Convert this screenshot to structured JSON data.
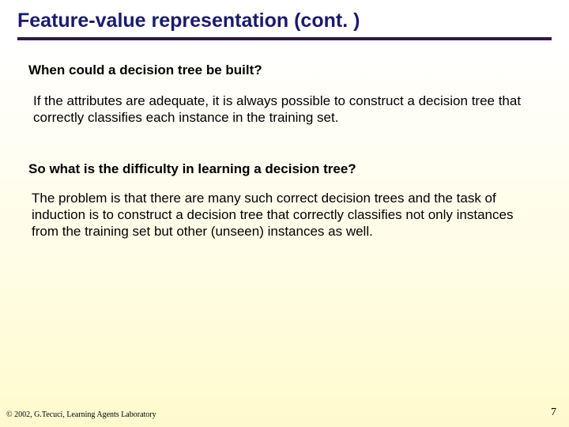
{
  "title": "Feature-value representation (cont. )",
  "q1": "When could a decision tree be built?",
  "a1": "If the attributes are adequate, it is always possible to construct a decision tree that correctly classifies each instance in the training set.",
  "q2": "So what is the difficulty in learning a decision tree?",
  "a2": "The problem is that there are many such correct decision trees and the task of induction is to construct a decision tree that correctly classifies not only instances from the training set but other (unseen) instances as well.",
  "footer_left": "© 2002, G.Tecuci, Learning Agents Laboratory",
  "footer_right": "7"
}
